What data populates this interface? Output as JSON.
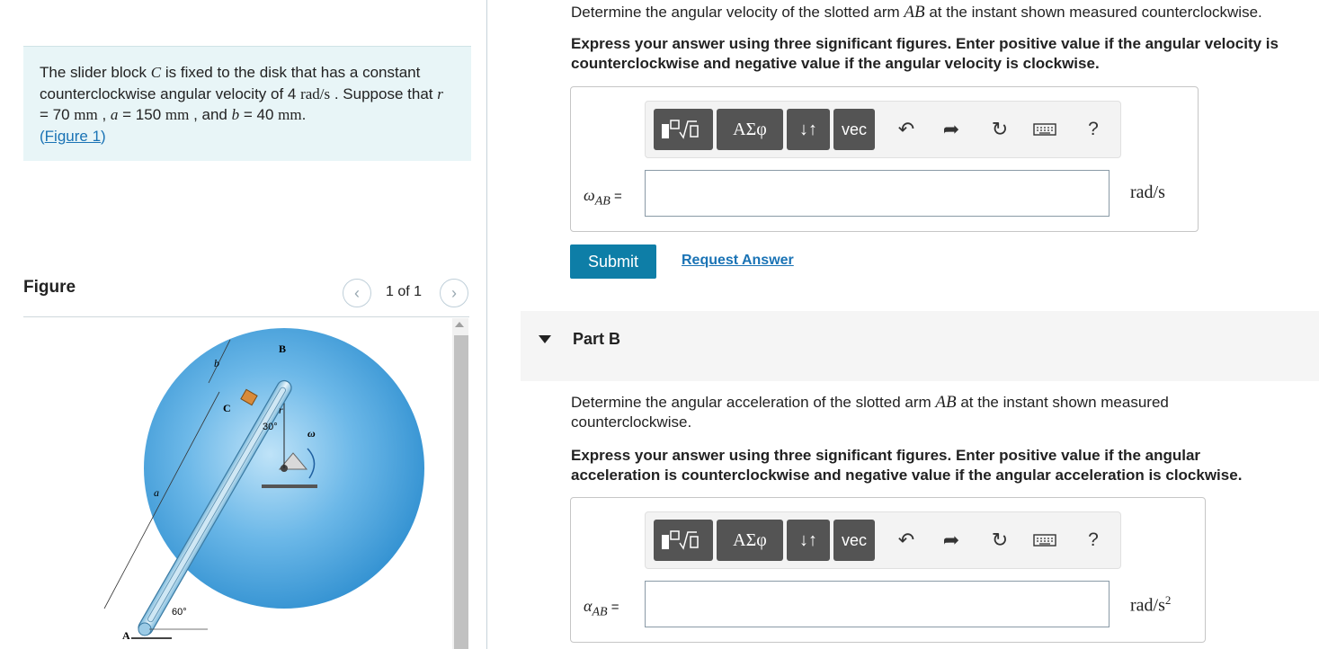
{
  "problem": {
    "text_1": "The slider block ",
    "var_C": "C",
    "text_2": " is fixed to the disk that has a constant counterclockwise angular velocity of 4 ",
    "unit_rads": "rad/s",
    "text_3": " . Suppose that ",
    "var_r": "r",
    "text_4": " = 70 ",
    "unit_mm1": "mm",
    "text_5": " , ",
    "var_a": "a",
    "text_6": " = 150 ",
    "unit_mm2": "mm",
    "text_7": " , and ",
    "var_b": "b",
    "text_8": " = 40 ",
    "unit_mm3": "mm",
    "text_9": ".",
    "figure_link_open": "(",
    "figure_link": "Figure 1",
    "figure_link_close": ")"
  },
  "figure": {
    "title": "Figure",
    "counter": "1 of 1",
    "prev_icon": "chevron-left-icon",
    "next_icon": "chevron-right-icon",
    "labels": {
      "A": "A",
      "B": "B",
      "C": "C",
      "a": "a",
      "b": "b",
      "r": "r",
      "omega": "ω",
      "angle30": "30°",
      "angle60": "60°"
    }
  },
  "partA": {
    "q_1": "Determine the angular velocity of the slotted arm ",
    "q_var": "AB",
    "q_2": " at the instant shown measured counterclockwise.",
    "instruction": "Express your answer using three significant figures. Enter positive value if the angular velocity is counterclockwise and negative value if the angular velocity is clockwise.",
    "label_symbol": "ω",
    "label_sub": "AB",
    "label_eq": " =",
    "input_value": "",
    "unit": "rad/s",
    "submit": "Submit",
    "request_answer": "Request Answer"
  },
  "partB": {
    "title": "Part B",
    "q_1": "Determine the angular acceleration of the slotted arm ",
    "q_var": "AB",
    "q_2": " at the instant shown measured counterclockwise.",
    "instruction": "Express your answer using three significant figures. Enter positive value if the angular acceleration is counterclockwise and negative value if the angular acceleration is clockwise.",
    "label_symbol": "α",
    "label_sub": "AB",
    "label_eq": " =",
    "input_value": "",
    "unit_base": "rad/s",
    "unit_exp": "2"
  },
  "toolbar": {
    "templates_icon": "fraction-sqrt-templates-icon",
    "greek": "ΑΣφ",
    "arrows": "↓↑",
    "vec": "vec",
    "undo_icon": "undo-icon",
    "redo_icon": "redo-icon",
    "reset_icon": "reset-icon",
    "keyboard_icon": "keyboard-icon",
    "help": "?"
  },
  "colors": {
    "accent": "#0e7ea7",
    "link": "#1a73b5",
    "problem_bg": "#e8f5f7",
    "toolbar_btn": "#545454",
    "disk": "#4aa3dc"
  }
}
